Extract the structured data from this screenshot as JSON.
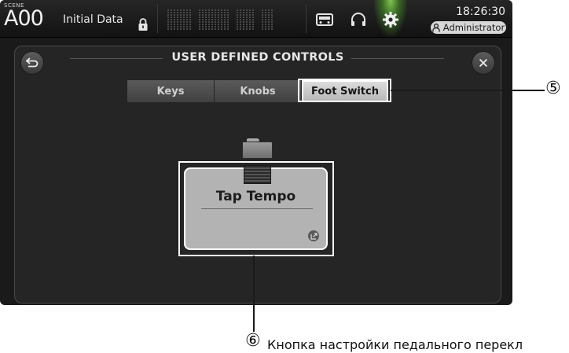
{
  "topbar": {
    "scene_label": "SCENE",
    "scene_number": "A00",
    "scene_name": "Initial Data",
    "time": "18:26:30",
    "user": "Administrator"
  },
  "dialog": {
    "title": "USER DEFINED CONTROLS",
    "tabs": [
      {
        "label": "Keys",
        "active": false
      },
      {
        "label": "Knobs",
        "active": false
      },
      {
        "label": "Foot Switch",
        "active": true
      }
    ],
    "foot_switch_function": "Tap Tempo"
  },
  "annotations": {
    "marker_5": "⑤",
    "marker_6": "⑥",
    "caption_6": "Кнопка настройки педального перекл"
  },
  "colors": {
    "accent_green": "#7fc64f",
    "active_tab": "#dcdcdc"
  }
}
